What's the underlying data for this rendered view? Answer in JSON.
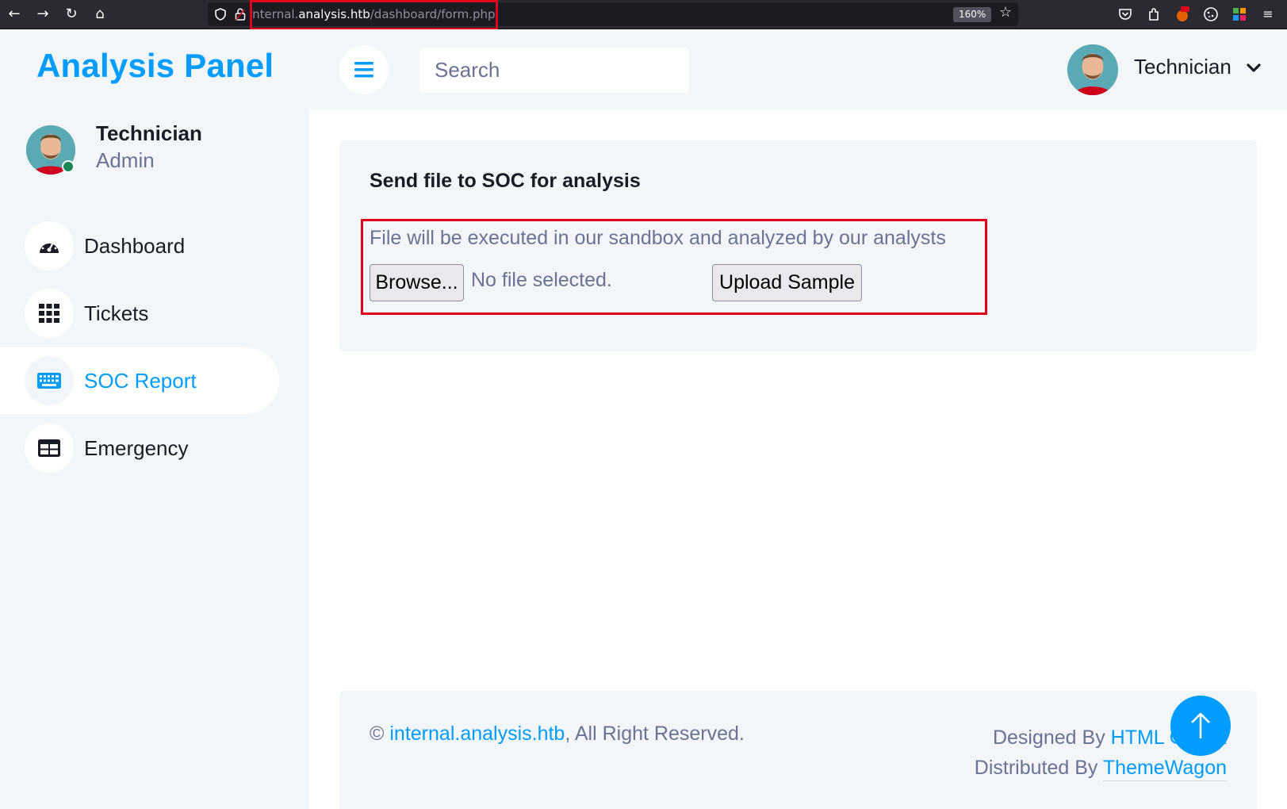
{
  "browser": {
    "url_prefix": "internal.",
    "url_host": "analysis.htb",
    "url_path": "/dashboard/form.php",
    "zoom": "160%",
    "back_icon": "←",
    "forward_icon": "→",
    "reload_icon": "↻",
    "home_icon": "⌂",
    "star_icon": "☆",
    "menu_icon": "≡"
  },
  "sidebar": {
    "brand": "Analysis Panel",
    "user": {
      "name": "Technician",
      "role": "Admin"
    },
    "items": [
      {
        "label": "Dashboard",
        "icon": "gauge-icon",
        "active": false
      },
      {
        "label": "Tickets",
        "icon": "grid-icon",
        "active": false
      },
      {
        "label": "SOC Report",
        "icon": "keyboard-icon",
        "active": true
      },
      {
        "label": "Emergency",
        "icon": "table-icon",
        "active": false
      }
    ]
  },
  "topbar": {
    "search_placeholder": "Search",
    "user_name": "Technician"
  },
  "form": {
    "title": "Send file to SOC for analysis",
    "hint": "File will be executed in our sandbox and analyzed by our analysts",
    "browse_label": "Browse...",
    "file_status": "No file selected.",
    "upload_label": "Upload Sample"
  },
  "footer": {
    "copyright_symbol": "©",
    "site_link": "internal.analysis.htb",
    "rights": ", All Right Reserved.",
    "designed_by": "Designed By ",
    "designed_link": "HTML Codex",
    "distributed_by": "Distributed By ",
    "distributed_link": "ThemeWagon"
  },
  "colors": {
    "accent": "#009cff",
    "highlight_box": "#e0001b",
    "text_dark": "#191c24",
    "text_muted": "#6c7293",
    "panel_bg": "#f3f6f9"
  }
}
